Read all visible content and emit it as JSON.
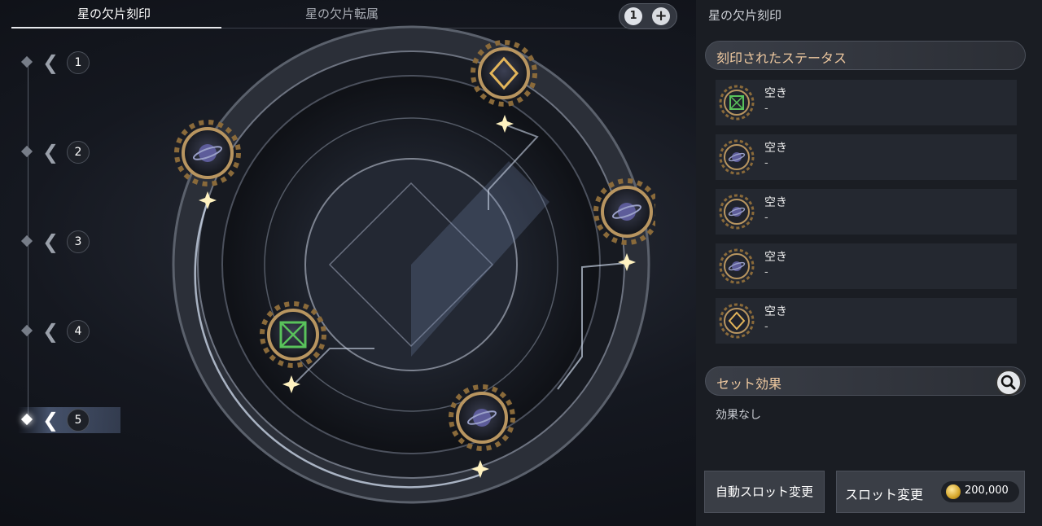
{
  "tabs": [
    {
      "label": "星の欠片刻印",
      "active": true
    },
    {
      "label": "星の欠片転属",
      "active": false
    }
  ],
  "slot_count": "1",
  "plus_label": "+",
  "slots": [
    {
      "number": "1",
      "active": false
    },
    {
      "number": "2",
      "active": false
    },
    {
      "number": "3",
      "active": false
    },
    {
      "number": "4",
      "active": false
    },
    {
      "number": "5",
      "active": true
    }
  ],
  "right_panel": {
    "title": "星の欠片刻印",
    "engraved_header": "刻印されたステータス",
    "statuses": [
      {
        "name": "空き",
        "value": "-",
        "icon": "green-rune-icon"
      },
      {
        "name": "空き",
        "value": "-",
        "icon": "planet-icon"
      },
      {
        "name": "空き",
        "value": "-",
        "icon": "planet-icon"
      },
      {
        "name": "空き",
        "value": "-",
        "icon": "planet-icon"
      },
      {
        "name": "空き",
        "value": "-",
        "icon": "gold-rune-icon"
      }
    ],
    "set_effect_header": "セット効果",
    "set_effect_text": "効果なし",
    "auto_button": "自動スロット変更",
    "slot_button": "スロット変更",
    "cost": "200,000"
  },
  "colors": {
    "accent_gold": "#efc9a0",
    "panel_bg": "#1a1d23"
  }
}
